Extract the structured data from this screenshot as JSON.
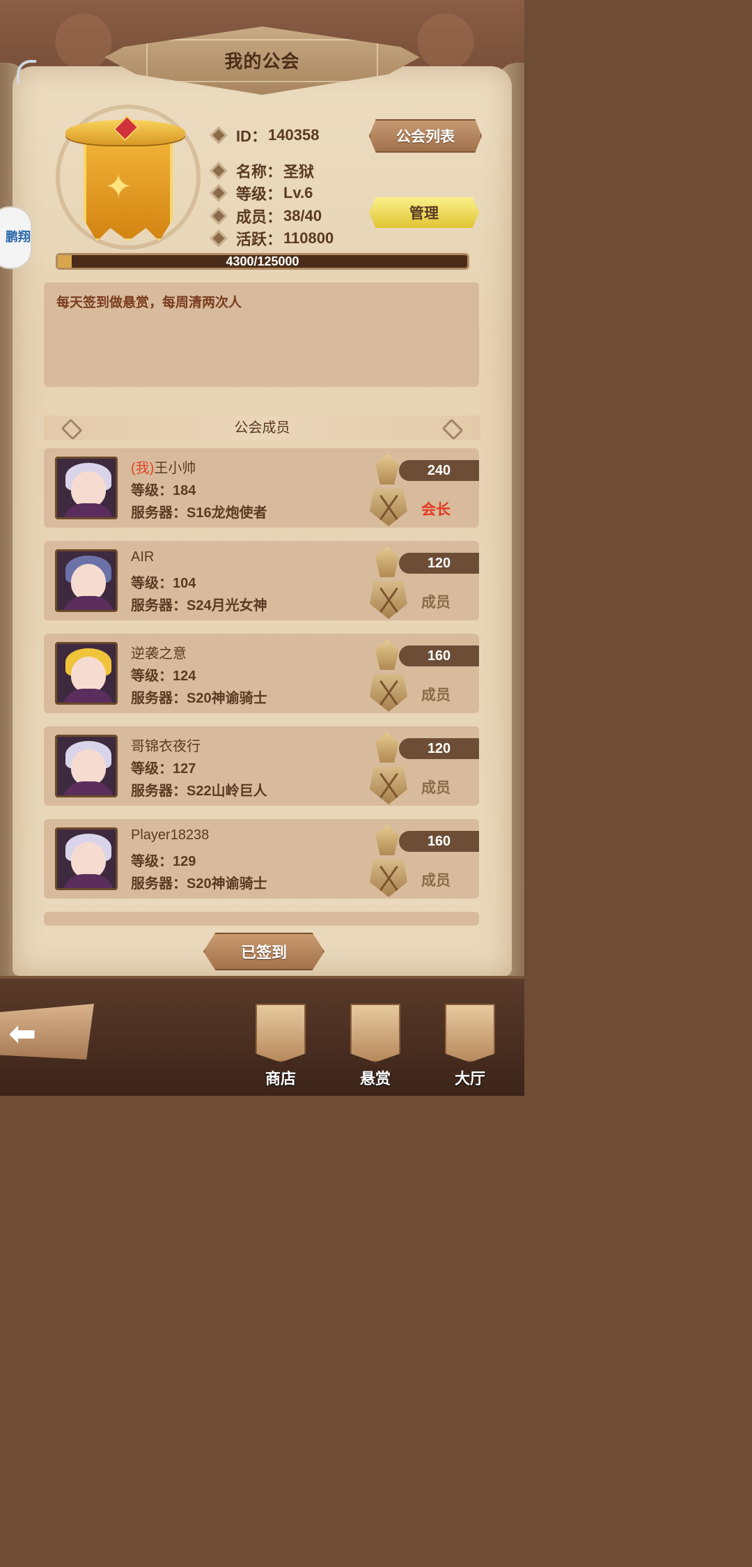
{
  "header": {
    "title": "我的公会"
  },
  "side_badge": {
    "text": "鹏翔"
  },
  "guild": {
    "id_label": "ID：",
    "id": "140358",
    "name_label": "名称：",
    "name": "圣狱",
    "level_label": "等级：",
    "level": "Lv.6",
    "members_label": "成员：",
    "members": "38/40",
    "activity_label": "活跃：",
    "activity": "110800",
    "xp_text": "4300/125000",
    "xp_fraction": 0.0344,
    "notice": "每天签到做悬赏，每周清两次人"
  },
  "buttons": {
    "guild_list": "公会列表",
    "manage": "管理",
    "signed": "已签到"
  },
  "members_section": {
    "title": "公会成员"
  },
  "members": [
    {
      "prefix": "(我)",
      "name": "王小帅",
      "level_label": "等级：",
      "level": "184",
      "server_label": "服务器：",
      "server": "S16龙炮使者",
      "activity": "240",
      "role": "会长",
      "hair": "#d9d4ea"
    },
    {
      "prefix": "",
      "name": "AIR",
      "level_label": "等级：",
      "level": "104",
      "server_label": "服务器：",
      "server": "S24月光女神",
      "activity": "120",
      "role": "成员",
      "hair": "#6a72a8"
    },
    {
      "prefix": "",
      "name": "逆袭之意",
      "level_label": "等级：",
      "level": "124",
      "server_label": "服务器：",
      "server": "S20神谕骑士",
      "activity": "160",
      "role": "成员",
      "hair": "#f0c43a"
    },
    {
      "prefix": "",
      "name": "哥锦衣夜行",
      "level_label": "等级：",
      "level": "127",
      "server_label": "服务器：",
      "server": "S22山岭巨人",
      "activity": "120",
      "role": "成员",
      "hair": "#d9d4ea"
    },
    {
      "prefix": "",
      "name": "Player18238",
      "level_label": "等级：",
      "level": "129",
      "server_label": "服务器：",
      "server": "S20神谕骑士",
      "activity": "160",
      "role": "成员",
      "hair": "#d9d4ea"
    }
  ],
  "nav": {
    "shop": "商店",
    "bounty": "悬赏",
    "hall": "大厅"
  }
}
